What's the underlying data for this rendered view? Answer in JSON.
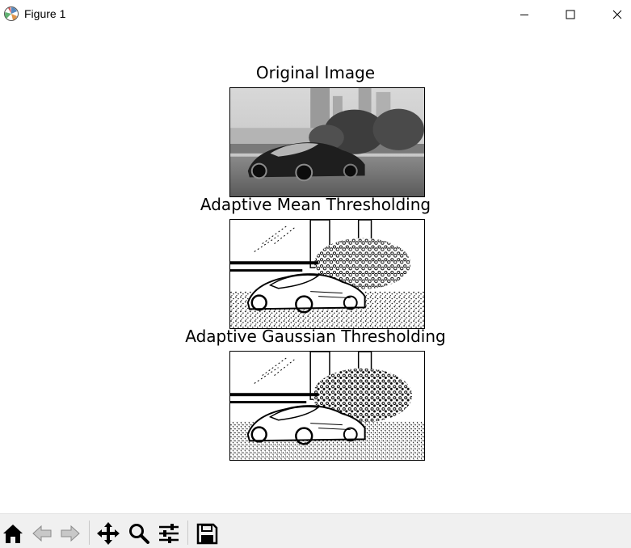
{
  "window": {
    "title": "Figure 1",
    "icon": "matplotlib-icon",
    "controls": [
      "minimize-icon",
      "maximize-icon",
      "close-icon"
    ]
  },
  "figure": {
    "axes": [
      {
        "title": "Original Image",
        "content": "grayscale photo of a sports car in front of trees and city buildings"
      },
      {
        "title": "Adaptive Mean Thresholding",
        "content": "binary thresholded version of the car photo"
      },
      {
        "title": "Adaptive Gaussian Thresholding",
        "content": "binary thresholded version of the car photo"
      }
    ]
  },
  "toolbar": {
    "buttons": [
      {
        "name": "home",
        "icon": "home-icon"
      },
      {
        "name": "back",
        "icon": "back-arrow-icon"
      },
      {
        "name": "forward",
        "icon": "forward-arrow-icon"
      },
      {
        "name": "pan",
        "icon": "move-icon"
      },
      {
        "name": "zoom",
        "icon": "zoom-icon"
      },
      {
        "name": "configure-subplots",
        "icon": "sliders-icon"
      },
      {
        "name": "save",
        "icon": "save-icon"
      }
    ]
  },
  "colors": {
    "toolbar_bg": "#f0f0f0",
    "figure_bg": "#ffffff",
    "text": "#000000"
  }
}
